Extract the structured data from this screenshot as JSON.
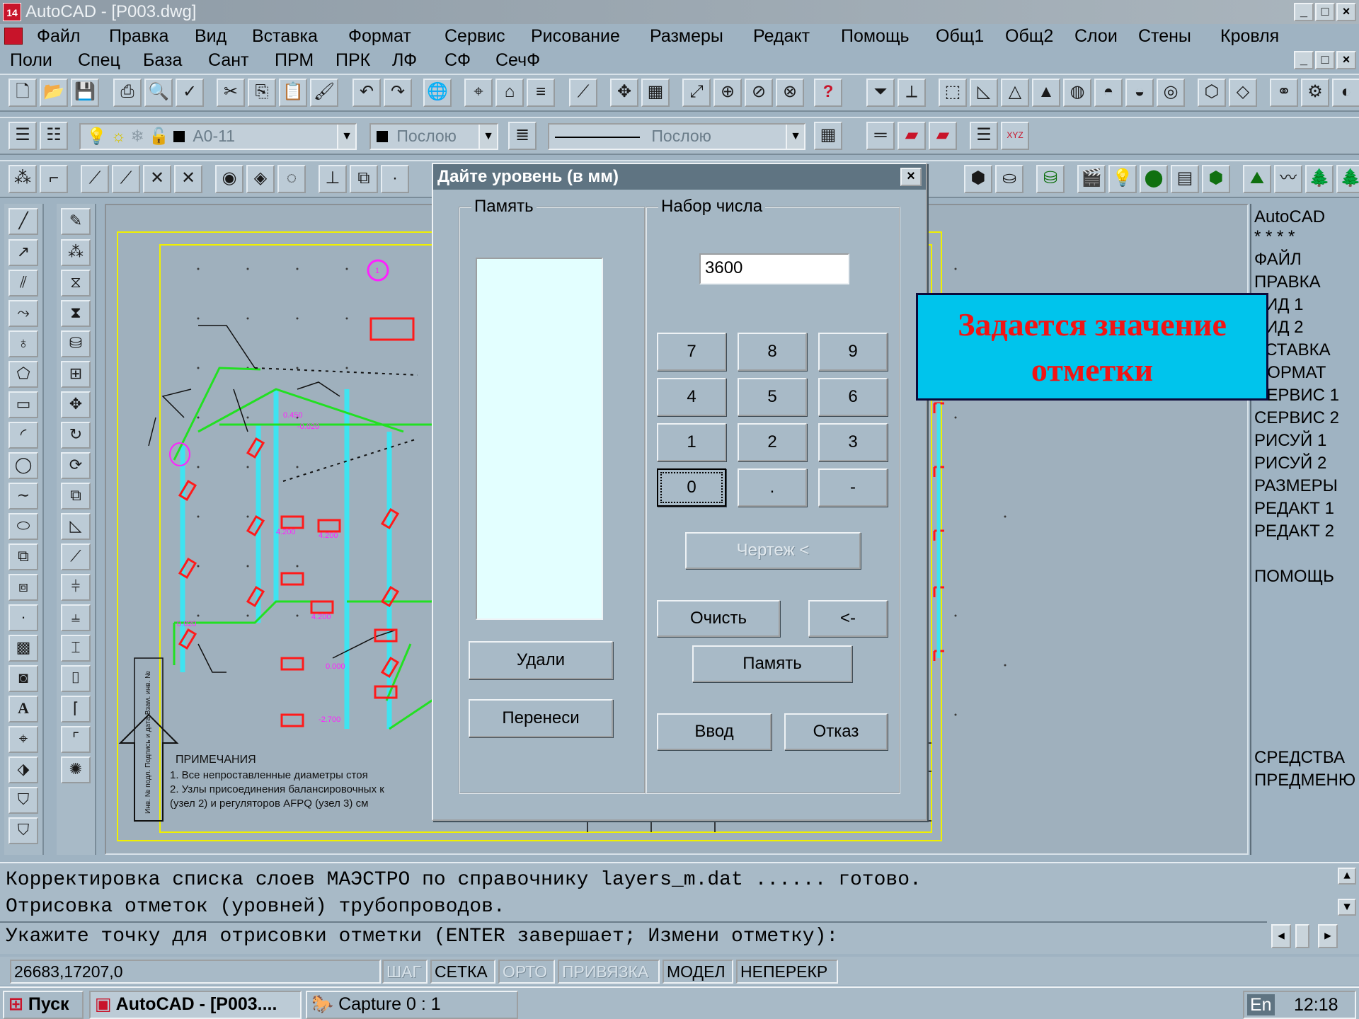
{
  "window": {
    "title": "AutoCAD - [P003.dwg]",
    "controls": [
      "_",
      "□",
      "×"
    ]
  },
  "menu_row1": [
    "Файл",
    "Правка",
    "Вид",
    "Вставка",
    "Формат",
    "Сервис",
    "Рисование",
    "Размеры",
    "Редакт",
    "Помощь",
    "Общ1",
    "Общ2",
    "Слои",
    "Стены",
    "Кровля"
  ],
  "menu_row2": [
    "Поли",
    "Спец",
    "База",
    "Сант",
    "ПРМ",
    "ПРК",
    "ЛФ",
    "СФ",
    "СечФ"
  ],
  "properties": {
    "layer": "A0-11",
    "color": "Послою",
    "linetype": "Послою"
  },
  "dialog": {
    "title": "Дайте уровень (в мм)",
    "memory_group": "Память",
    "number_group": "Набор числа",
    "value": "3600",
    "keypad": [
      "7",
      "8",
      "9",
      "4",
      "5",
      "6",
      "1",
      "2",
      "3",
      "0",
      ".",
      "-"
    ],
    "buttons": {
      "drawing": "Чертеж <",
      "clear": "Очисть",
      "backspace": "<-",
      "memory": "Память",
      "enter": "Ввод",
      "cancel": "Отказ",
      "delete": "Удали",
      "transfer": "Перенеси"
    }
  },
  "callout": {
    "line1": "Задается значение",
    "line2": "отметки"
  },
  "screen_menu": [
    "AutoCAD",
    "* * * *",
    "ФАЙЛ",
    "ПРАВКА",
    "ВИД 1",
    "ВИД 2",
    "ВСТАВКА",
    "ФОРМАТ",
    "СЕРВИС 1",
    "СЕРВИС 2",
    "РИСУЙ 1",
    "РИСУЙ 2",
    "РАЗМЕРЫ",
    "РЕДАКТ 1",
    "РЕДАКТ 2",
    "ПОМОЩЬ",
    "СРЕДСТВА",
    "ПРЕДМЕНЮ"
  ],
  "drawing_notes": {
    "heading": "ПРИМЕЧАНИЯ",
    "line1": "1. Все непроставленные диаметры стоя",
    "line2": "2. Узлы присоединения балансировочных к",
    "line3": "(узел 2) и регуляторов AFPQ (узел 3) см"
  },
  "command_line": {
    "line1": "Корректировка списка слоев МАЭСТРО по справочнику layers_m.dat ...... готово.",
    "line2": "Отрисовка отметок (уровней) трубопроводов.",
    "prompt": "Укажите точку для отрисовки отметки (ENTER завершает; Измени отметку):"
  },
  "status": {
    "coords": "26683,17207,0",
    "toggles": [
      {
        "label": "ШАГ",
        "on": false
      },
      {
        "label": "СЕТКА",
        "on": true
      },
      {
        "label": "ОРТО",
        "on": false
      },
      {
        "label": "ПРИВЯЗКА",
        "on": false
      },
      {
        "label": "МОДЕЛ",
        "on": true
      },
      {
        "label": "НЕПЕРЕКР",
        "on": true
      }
    ]
  },
  "taskbar": {
    "start": "Пуск",
    "items": [
      "AutoCAD - [P003....",
      "Capture 0 : 1"
    ],
    "lang": "En",
    "time": "12:18"
  },
  "colors": {
    "pipe_green": "#22e022",
    "riser_cyan": "#3fe3f0",
    "valve_red": "#ff1a1a",
    "label_magenta": "#ff20ff",
    "callout_bg": "#00c4ec",
    "callout_text": "#f21414"
  }
}
